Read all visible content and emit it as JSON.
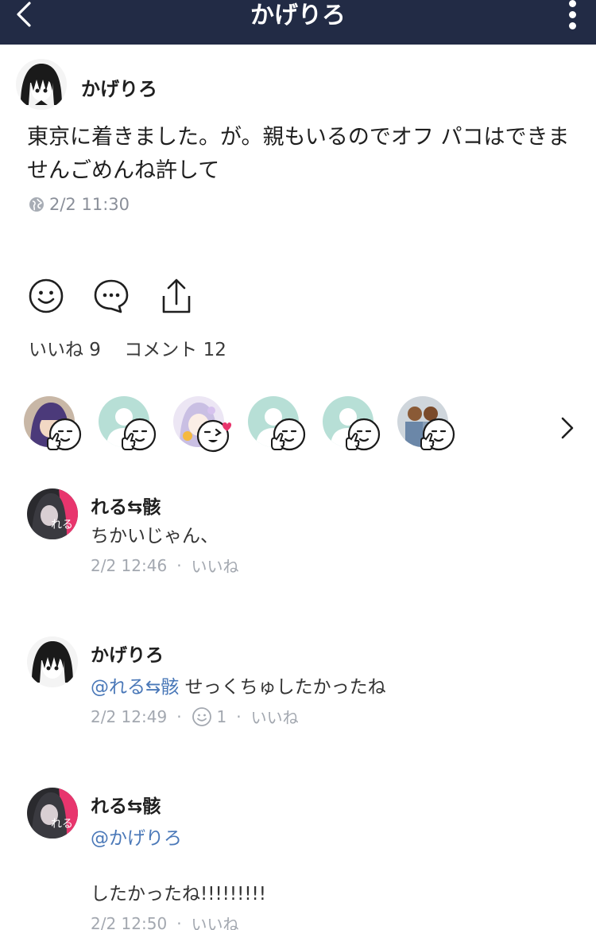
{
  "header": {
    "title": "かげりろ"
  },
  "post": {
    "author": "かげりろ",
    "text": "東京に着きました。が。親もいるのでオフ パコはできませんごめんね許して",
    "time": "2/2 11:30",
    "privacy_icon": "globe-icon"
  },
  "actions": {
    "icons": [
      "smiley-icon",
      "comment-bubble-icon",
      "share-icon"
    ]
  },
  "counts": {
    "likes": "いいね 9",
    "comments": "コメント 12"
  },
  "reactors": [
    {
      "avatar": "anime-avatar-purple"
    },
    {
      "avatar": "default-avatar"
    },
    {
      "avatar": "anime-avatar-lavender",
      "stamp": "wink-heart-stamp"
    },
    {
      "avatar": "default-avatar"
    },
    {
      "avatar": "default-avatar"
    },
    {
      "avatar": "photo-avatar"
    }
  ],
  "comments": [
    {
      "author": "れる⇆骸",
      "mention": "",
      "text": "ちかいじゃん、",
      "time": "2/2 12:46",
      "reaction_count": "",
      "like_label": "いいね"
    },
    {
      "author": "かげりろ",
      "mention": "@れる⇆骸",
      "text": " せっくちゅしたかったね",
      "time": "2/2 12:49",
      "reaction_count": "1",
      "like_label": "いいね"
    },
    {
      "author": "れる⇆骸",
      "mention": "@かげりろ",
      "text": "したかったね!!!!!!!!!",
      "time": "2/2 12:50",
      "reaction_count": "",
      "like_label": "いいね"
    }
  ],
  "colors": {
    "header_bg": "#222b45",
    "mention": "#4a78b8",
    "meta_gray": "#a3a8b0",
    "default_avatar": "#b7dfd6",
    "accent_pink": "#e8356d"
  }
}
